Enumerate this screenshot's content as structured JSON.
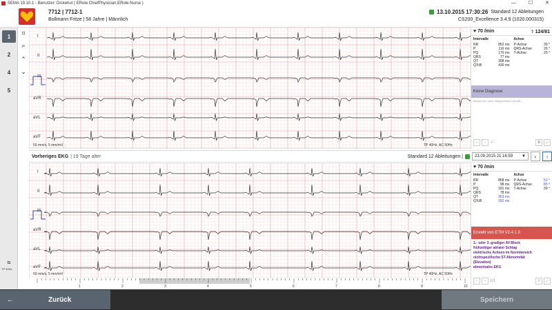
{
  "window": {
    "title": "SEMA 19.10.1 - Benutzer: Dickehut ( ERole.ChiefPhysician,ERole.Nurse )",
    "controls": [
      "—",
      "☐",
      "✕"
    ]
  },
  "patient": {
    "id_line": "7712 | 7712-1",
    "name_line": "Bollmann Fritze | 58 Jahre | Männlich"
  },
  "recording": {
    "datetime": "13.10.2015 17:30:26",
    "type": "Standard 12 Ableitungen",
    "device": "CS200_Excellence 3.4.9 (1020.000315)"
  },
  "toolbar": {
    "left": [
      "1",
      "2",
      "4",
      "5"
    ],
    "tools": [
      "crop-icon",
      "zoom-icon",
      "chevron-up-icon",
      "chevron-down-icon"
    ]
  },
  "current_ecg": {
    "leads": [
      "I",
      "II",
      "III",
      "aVR",
      "aVL",
      "aVF"
    ],
    "speed": "50 mm/s, 5 mm/mV",
    "filter": "TP 40Hz, AC 50Hz"
  },
  "previous": {
    "title": "Vorheriges EKG",
    "age": "| 19 Tage alter",
    "type": "Standard 12 Ableitungen |",
    "date": "23.09.2015 21:16:59",
    "leads": [
      "I",
      "II",
      "III",
      "aVR",
      "aVL",
      "aVF"
    ],
    "speed": "50 mm/s, 5 mm/mV",
    "filter": "TP 40Hz, AC 50Hz"
  },
  "panel1": {
    "hr": "70 /min",
    "bp": "124/81",
    "intervals_head": "Intervalle",
    "axis_head": "Achse",
    "intervals": [
      {
        "k": "RR",
        "v": "852 ms"
      },
      {
        "k": "P",
        "v": "116 ms"
      },
      {
        "k": "PQ",
        "v": "170 ms"
      },
      {
        "k": "QRS",
        "v": "77 ms"
      },
      {
        "k": "QT",
        "v": "398 ms"
      },
      {
        "k": "QTcB",
        "v": "430 ms"
      }
    ],
    "axes": [
      {
        "k": "P-Achse",
        "v": "39 °"
      },
      {
        "k": "QRS-Achse",
        "v": "26 °"
      },
      {
        "k": "T-Achse",
        "v": "25 °"
      }
    ],
    "diagnosis": "Keine Diagnose",
    "hint": "Klicken um neue Interpretation hinzufü...",
    "nav": "-/-"
  },
  "panel2": {
    "hr": "70 /min",
    "intervals_head": "Intervalle",
    "axis_head": "Achse",
    "intervals": [
      {
        "k": "RR",
        "v": "858 ms"
      },
      {
        "k": "P",
        "v": "98 ms"
      },
      {
        "k": "PQ",
        "v": "181 ms"
      },
      {
        "k": "QRS",
        "v": "78 ms"
      },
      {
        "k": "QT",
        "v": "363 ms"
      },
      {
        "k": "QTcB",
        "v": "392 ms"
      }
    ],
    "axes": [
      {
        "k": "P-Achse",
        "v": "52 °"
      },
      {
        "k": "QRS-Achse",
        "v": "85 °"
      },
      {
        "k": "T-Achse",
        "v": "39 °"
      }
    ],
    "created_by": "Erstellt von ETM V2.4.1.0",
    "diagnosis_lines": [
      "2.- oder 3.-gradiger AV-Block",
      "frühzeitiger atrialer Schlag",
      "elektrische Achsen im Normbereich",
      "nichtspezifische ST-Abnormität",
      "(Elevation)",
      "abnormales EKG"
    ],
    "nav": "1/1"
  },
  "ruler": {
    "marks": [
      "1",
      "2",
      "3",
      "4",
      "5",
      "6",
      "7",
      "8",
      "9",
      "10"
    ]
  },
  "filter_badge": "TP 40Hz",
  "buttons": {
    "back": "Zurück",
    "save": "Speichern"
  },
  "colors": {
    "grid_minor": "#f4c9c9",
    "grid_major": "#e89a9a",
    "trace": "#333333",
    "diag_purple": "#b8b4d8",
    "diag_red": "#d9534f",
    "diag_text": "#6a1b9a",
    "bottom_bar": "#2d2d2d"
  }
}
